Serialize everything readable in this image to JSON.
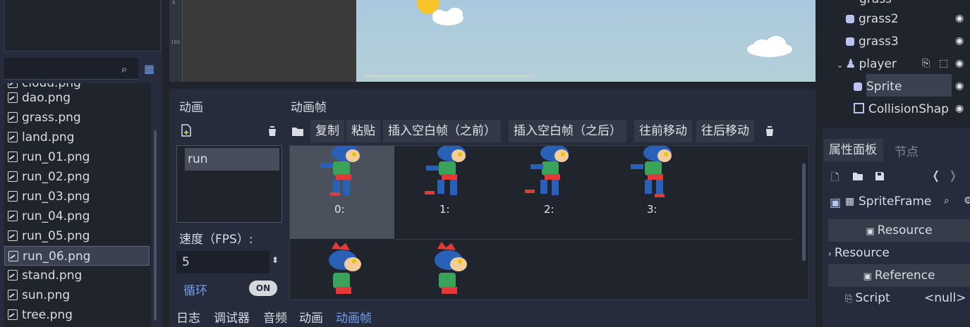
{
  "filesystem": {
    "files": [
      "cloud.png",
      "dao.png",
      "grass.png",
      "land.png",
      "run_01.png",
      "run_02.png",
      "run_03.png",
      "run_04.png",
      "run_05.png",
      "run_06.png",
      "stand.png",
      "sun.png",
      "tree.png"
    ],
    "selected": "run_06.png"
  },
  "ruler": {
    "tick_a": "8",
    "tick_b": "160"
  },
  "animations": {
    "title": "动画",
    "items": [
      "run"
    ],
    "speed_label": "速度（FPS）:",
    "fps": "5",
    "loop_label": "循环",
    "loop_toggle": "ON"
  },
  "frames": {
    "title": "动画帧",
    "toolbar": {
      "copy": "复制",
      "paste": "粘贴",
      "insert_before": "插入空白帧（之前）",
      "insert_after": "插入空白帧（之后）",
      "move_forward": "往前移动",
      "move_back": "往后移动"
    },
    "frame_labels": [
      "0:",
      "1:",
      "2:",
      "3:"
    ]
  },
  "bottom_tabs": [
    "日志",
    "调试器",
    "音频",
    "动画",
    "动画帧"
  ],
  "scene_tree": {
    "partial_top": "grass",
    "items": [
      "grass2",
      "grass3",
      "player",
      "Sprite",
      "CollisionShap"
    ]
  },
  "inspector": {
    "tabs": [
      "属性面板",
      "节点"
    ],
    "resource_type": "SpriteFrame",
    "section_resource": "Resource",
    "resource_row": "Resource",
    "section_reference": "Reference",
    "script_label": "Script",
    "script_value": "<null>"
  },
  "colors": {
    "accent": "#6fa0f0",
    "bg_dark": "#20242d",
    "panel": "#262c3b"
  }
}
